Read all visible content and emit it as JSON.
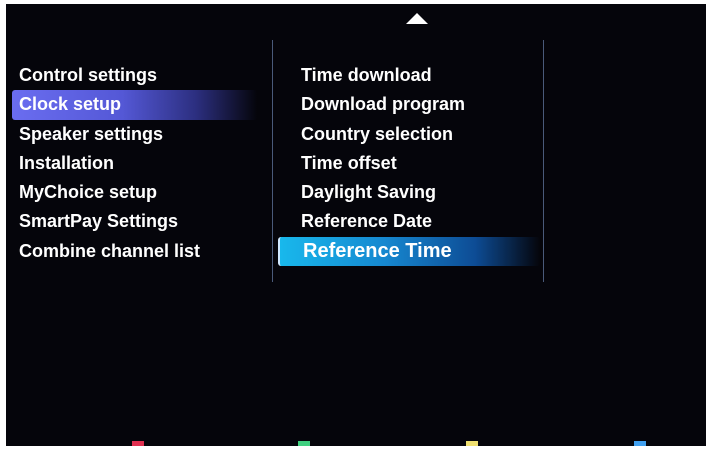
{
  "menu_left": {
    "items": [
      {
        "label": "Control settings"
      },
      {
        "label": "Clock setup"
      },
      {
        "label": "Speaker settings"
      },
      {
        "label": "Installation"
      },
      {
        "label": "MyChoice setup"
      },
      {
        "label": "SmartPay Settings"
      },
      {
        "label": "Combine channel list"
      }
    ],
    "selected": "Clock setup"
  },
  "menu_right": {
    "items": [
      {
        "label": "Time download"
      },
      {
        "label": "Download program"
      },
      {
        "label": "Country selection"
      },
      {
        "label": "Time offset"
      },
      {
        "label": "Daylight Saving"
      },
      {
        "label": "Reference Date"
      },
      {
        "label": "Reference Time"
      }
    ],
    "selected": "Reference Time"
  },
  "colors": {
    "background": "#05050b",
    "left_highlight": "#5458d6",
    "right_highlight": "#18b8ec",
    "key_red": "#e03050",
    "key_green": "#40d080",
    "key_yellow": "#f0e070",
    "key_blue": "#40a0f0"
  },
  "icons": {
    "scroll_up": "up-triangle-icon"
  }
}
